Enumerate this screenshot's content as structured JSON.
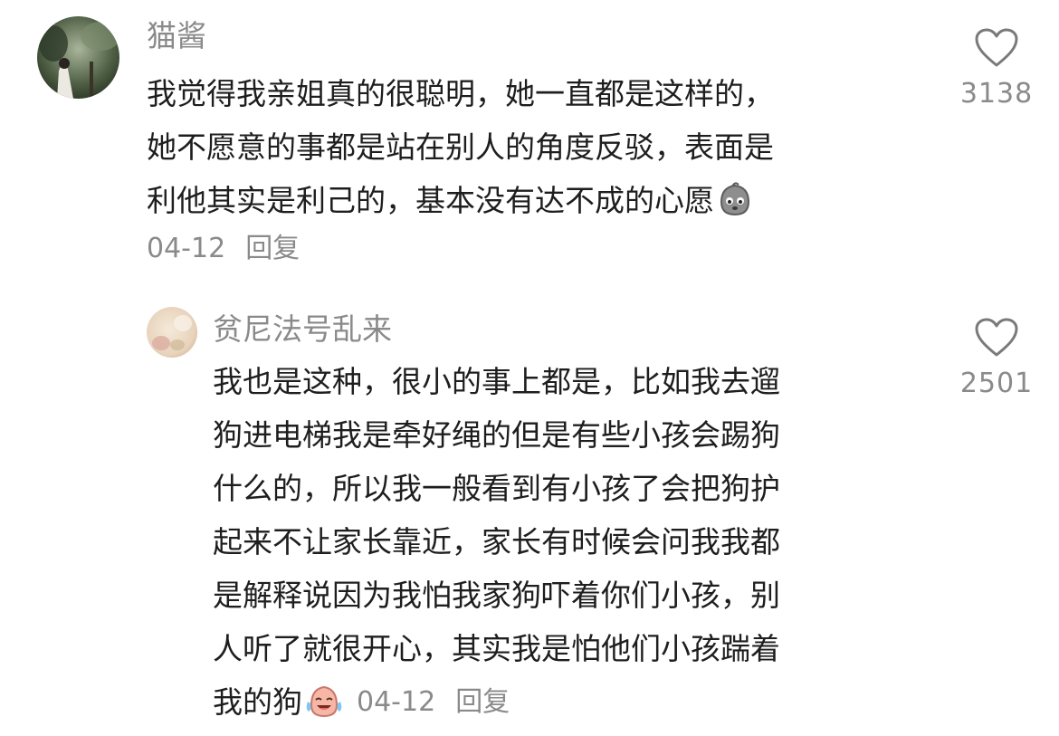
{
  "comments": [
    {
      "username": "猫酱",
      "lines": [
        "我觉得我亲姐真的很聪明，她一直都是这样的，",
        "她不愿意的事都是站在别人的角度反驳，表面是",
        "利他其实是利己的，基本没有达不成的心愿"
      ],
      "emoji": "sweat-face-emoji",
      "date": "04-12",
      "reply_label": "回复",
      "like_count": "3138"
    },
    {
      "username": "贫尼法号乱来",
      "lines": [
        "我也是这种，很小的事上都是，比如我去遛",
        "狗进电梯我是牵好绳的但是有些小孩会踢狗",
        "什么的，所以我一般看到有小孩了会把狗护",
        "起来不让家长靠近，家长有时候会问我我都",
        "是解释说因为我怕我家狗吓着你们小孩，别",
        "人听了就很开心，其实我是怕他们小孩踹着",
        "我的狗"
      ],
      "emoji": "laughing-crying-face-emoji",
      "date": "04-12",
      "reply_label": "回复",
      "like_count": "2501"
    }
  ],
  "icons": {
    "like": "heart-outline-icon"
  },
  "colors": {
    "secondary_text": "#8a8a8a",
    "primary_text": "#1e1e1e",
    "background": "#ffffff"
  }
}
